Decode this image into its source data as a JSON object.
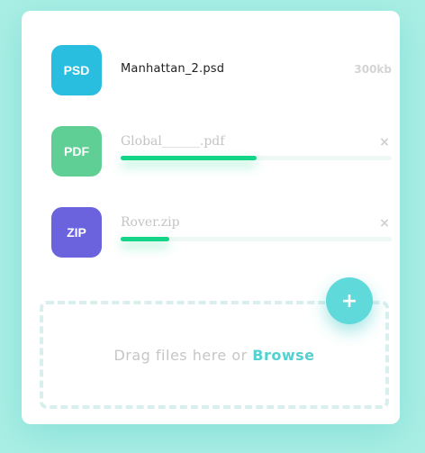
{
  "files": [
    {
      "type_label": "PSD",
      "name": "Manhattan_2.psd",
      "size": "300kb",
      "badge_color": "#29bde0",
      "status": "complete"
    },
    {
      "type_label": "PDF",
      "name": "Global______.pdf",
      "badge_color": "#5fcf95",
      "status": "uploading",
      "progress": 0.5
    },
    {
      "type_label": "ZIP",
      "name": "Rover.zip",
      "badge_color": "#6b63dd",
      "status": "uploading",
      "progress": 0.18
    }
  ],
  "remove_icon": "×",
  "remove_icon_name": "close-icon",
  "add_button": {
    "icon": "+",
    "icon_name": "plus-icon"
  },
  "drop_zone": {
    "text": "Drag files here or ",
    "browse_label": "Browse"
  },
  "colors": {
    "accent": "#52d1d1",
    "progress": "#14d487",
    "background": "#aaeee5"
  }
}
